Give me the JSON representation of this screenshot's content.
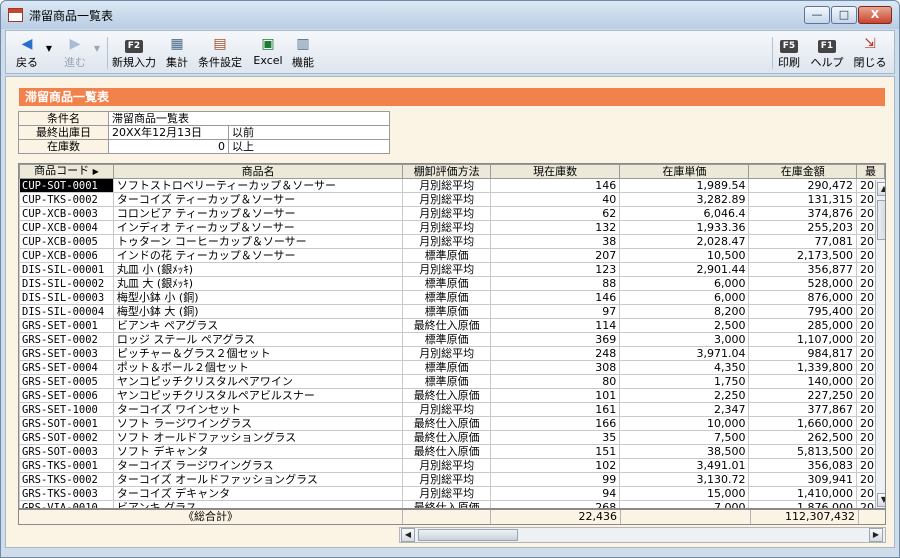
{
  "window": {
    "title": "滞留商品一覧表",
    "min": "—",
    "max": "□",
    "close": "X"
  },
  "toolbar": {
    "back": "戻る",
    "forward": "進む",
    "f2": "F2",
    "new_entry": "新規入力",
    "tally": "集計",
    "condition": "条件設定",
    "excel": "Excel",
    "function": "機能",
    "f5": "F5",
    "print": "印刷",
    "f1": "F1",
    "help": "ヘルプ",
    "close": "閉じる"
  },
  "banner": "滞留商品一覧表",
  "conditions": [
    {
      "label": "条件名",
      "value": "滞留商品一覧表",
      "extra": ""
    },
    {
      "label": "最終出庫日",
      "value": "20XX年12月13日",
      "extra": "以前"
    },
    {
      "label": "在庫数",
      "value": "0",
      "extra": "以上"
    }
  ],
  "columns": [
    "商品コード",
    "商品名",
    "棚卸評価方法",
    "現在庫数",
    "在庫単価",
    "在庫金額",
    "最"
  ],
  "rows": [
    [
      "CUP-SOT-0001",
      "ソフトストロベリーティーカップ＆ソーサー",
      "月別総平均",
      "146",
      "1,989.54",
      "290,472",
      "20"
    ],
    [
      "CUP-TKS-0002",
      "ターコイズ ティーカップ＆ソーサー",
      "月別総平均",
      "40",
      "3,282.89",
      "131,315",
      "20"
    ],
    [
      "CUP-XCB-0003",
      "コロンビア ティーカップ＆ソーサー",
      "月別総平均",
      "62",
      "6,046.4",
      "374,876",
      "20"
    ],
    [
      "CUP-XCB-0004",
      "インディオ ティーカップ＆ソーサー",
      "月別総平均",
      "132",
      "1,933.36",
      "255,203",
      "20"
    ],
    [
      "CUP-XCB-0005",
      "トゥターン コーヒーカップ＆ソーサー",
      "月別総平均",
      "38",
      "2,028.47",
      "77,081",
      "20"
    ],
    [
      "CUP-XCB-0006",
      "インドの花 ティーカップ＆ソーサー",
      "標準原価",
      "207",
      "10,500",
      "2,173,500",
      "20"
    ],
    [
      "DIS-SIL-00001",
      "丸皿 小 (銀ﾒｯｷ)",
      "月別総平均",
      "123",
      "2,901.44",
      "356,877",
      "20"
    ],
    [
      "DIS-SIL-00002",
      "丸皿 大 (銀ﾒｯｷ)",
      "標準原価",
      "88",
      "6,000",
      "528,000",
      "20"
    ],
    [
      "DIS-SIL-00003",
      "梅型小鉢 小 (銅)",
      "標準原価",
      "146",
      "6,000",
      "876,000",
      "20"
    ],
    [
      "DIS-SIL-00004",
      "梅型小鉢 大 (銅)",
      "標準原価",
      "97",
      "8,200",
      "795,400",
      "20"
    ],
    [
      "GRS-SET-0001",
      "ビアンキ ペアグラス",
      "最終仕入原価",
      "114",
      "2,500",
      "285,000",
      "20"
    ],
    [
      "GRS-SET-0002",
      "ロッジ ステール ペアグラス",
      "標準原価",
      "369",
      "3,000",
      "1,107,000",
      "20"
    ],
    [
      "GRS-SET-0003",
      "ピッチャー＆グラス２個セット",
      "月別総平均",
      "248",
      "3,971.04",
      "984,817",
      "20"
    ],
    [
      "GRS-SET-0004",
      "ポット＆ボール２個セット",
      "標準原価",
      "308",
      "4,350",
      "1,339,800",
      "20"
    ],
    [
      "GRS-SET-0005",
      "ヤンコピッチクリスタルペアワイン",
      "標準原価",
      "80",
      "1,750",
      "140,000",
      "20"
    ],
    [
      "GRS-SET-0006",
      "ヤンコピッチクリスタルペアビルスナー",
      "最終仕入原価",
      "101",
      "2,250",
      "227,250",
      "20"
    ],
    [
      "GRS-SET-1000",
      "ターコイズ ワインセット",
      "月別総平均",
      "161",
      "2,347",
      "377,867",
      "20"
    ],
    [
      "GRS-SOT-0001",
      "ソフト ラージワイングラス",
      "最終仕入原価",
      "166",
      "10,000",
      "1,660,000",
      "20"
    ],
    [
      "GRS-SOT-0002",
      "ソフト オールドファッショングラス",
      "最終仕入原価",
      "35",
      "7,500",
      "262,500",
      "20"
    ],
    [
      "GRS-SOT-0003",
      "ソフト デキャンタ",
      "最終仕入原価",
      "151",
      "38,500",
      "5,813,500",
      "20"
    ],
    [
      "GRS-TKS-0001",
      "ターコイズ ラージワイングラス",
      "月別総平均",
      "102",
      "3,491.01",
      "356,083",
      "20"
    ],
    [
      "GRS-TKS-0002",
      "ターコイズ オールドファッショングラス",
      "月別総平均",
      "99",
      "3,130.72",
      "309,941",
      "20"
    ],
    [
      "GRS-TKS-0003",
      "ターコイズ デキャンタ",
      "月別総平均",
      "94",
      "15,000",
      "1,410,000",
      "20"
    ],
    [
      "GRS-VIA-0010",
      "ビアンキ グラス",
      "最終仕入原価",
      "268",
      "7,000",
      "1,876,000",
      "20"
    ]
  ],
  "totals": {
    "label": "《総合計》",
    "qty": "22,436",
    "amount": "112,307,432"
  }
}
